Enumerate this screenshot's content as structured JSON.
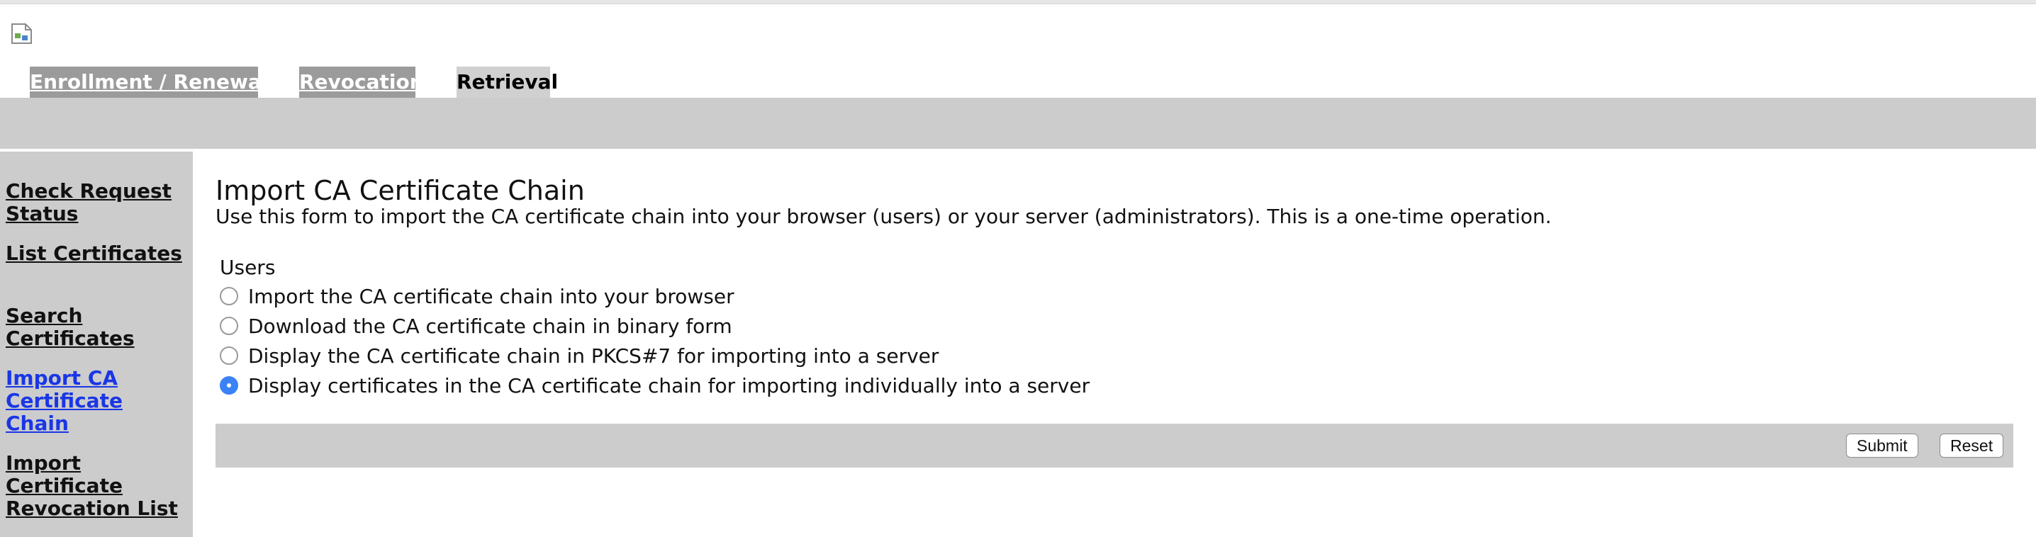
{
  "tabs": [
    {
      "label": "Enrollment / Renewal",
      "active": false
    },
    {
      "label": "Revocation",
      "active": false
    },
    {
      "label": "Retrieval",
      "active": true
    }
  ],
  "sidebar": {
    "items": [
      {
        "label": "Check Request Status",
        "current": false
      },
      {
        "label": "List Certificates",
        "current": false
      },
      {
        "label": "Search Certificates",
        "current": false
      },
      {
        "label": "Import CA Certificate Chain",
        "current": true
      },
      {
        "label": "Import Certificate Revocation List",
        "current": false
      }
    ]
  },
  "main": {
    "title": "Import CA Certificate Chain",
    "description": "Use this form to import the CA certificate chain into your browser (users) or your server (administrators). This is a one-time operation.",
    "group_label": "Users",
    "options": [
      {
        "label": "Import the CA certificate chain into your browser",
        "checked": false
      },
      {
        "label": "Download the CA certificate chain in binary form",
        "checked": false
      },
      {
        "label": "Display the CA certificate chain in PKCS#7 for importing into a server",
        "checked": false
      },
      {
        "label": "Display certificates in the CA certificate chain for importing individually into a server",
        "checked": true
      }
    ],
    "submit_label": "Submit",
    "reset_label": "Reset"
  },
  "colors": {
    "band": "#cccccc",
    "inactive_tab": "#9b9b9b",
    "active_tab": "#d0d0d0",
    "current_link": "#1a36e6",
    "radio_checked": "#3b82f6"
  }
}
